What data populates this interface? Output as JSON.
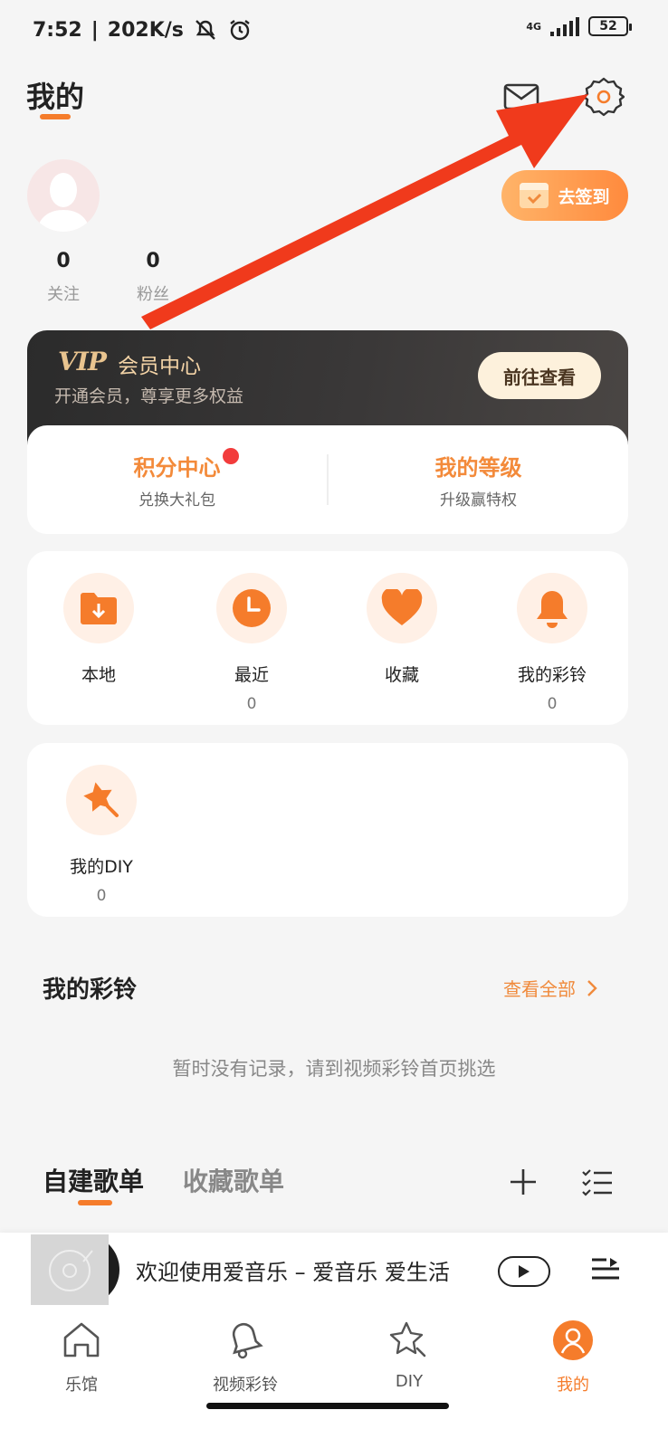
{
  "status_bar": {
    "time": "7:52",
    "speed": "202K/s",
    "network": "4G",
    "battery": "52"
  },
  "header": {
    "title": "我的"
  },
  "profile": {
    "checkin_label": "去签到",
    "following_count": "0",
    "following_label": "关注",
    "fans_count": "0",
    "fans_label": "粉丝"
  },
  "vip": {
    "logo": "VIP",
    "title": "会员中心",
    "subtitle": "开通会员，尊享更多权益",
    "button": "前往查看"
  },
  "points": {
    "left_title": "积分中心",
    "left_sub": "兑换大礼包",
    "right_title": "我的等级",
    "right_sub": "升级赢特权"
  },
  "shortcuts": [
    {
      "label": "本地",
      "count": ""
    },
    {
      "label": "最近",
      "count": "0"
    },
    {
      "label": "收藏",
      "count": ""
    },
    {
      "label": "我的彩铃",
      "count": "0"
    }
  ],
  "diy": {
    "label": "我的DIY",
    "count": "0"
  },
  "ringtone_section": {
    "title": "我的彩铃",
    "view_all": "查看全部",
    "empty": "暂时没有记录，请到视频彩铃首页挑选"
  },
  "playlist_tabs": {
    "created": "自建歌单",
    "favorites": "收藏歌单"
  },
  "player": {
    "song": "欢迎使用爱音乐 – 爱音乐  爱生活"
  },
  "nav": [
    {
      "label": "乐馆"
    },
    {
      "label": "视频彩铃"
    },
    {
      "label": "DIY"
    },
    {
      "label": "我的"
    }
  ],
  "colors": {
    "accent": "#f57c2b",
    "arrow": "#f03a1c",
    "vip_bg": "#2b2b2b",
    "badge": "#f23c3c"
  }
}
